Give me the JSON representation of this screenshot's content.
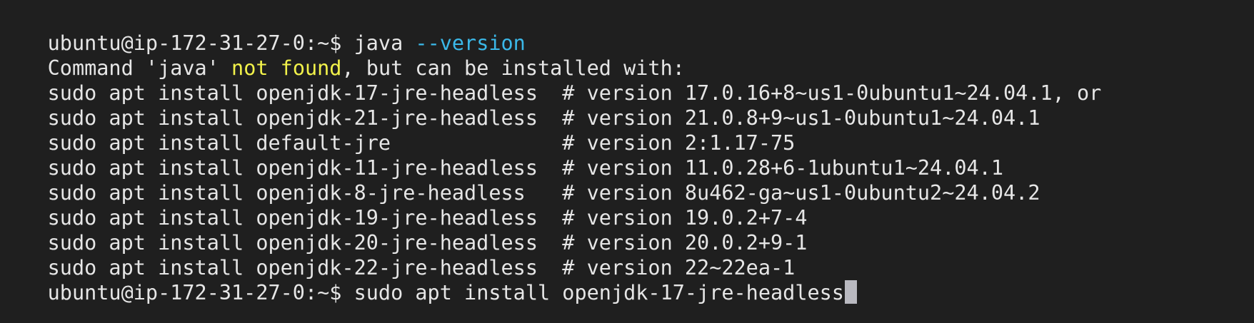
{
  "terminal": {
    "colors": {
      "background": "#1f1f1f",
      "foreground": "#e6e6e6",
      "option": "#3bb8e8",
      "highlight": "#f2f24a",
      "cursor": "#b9b9c0"
    },
    "command1": {
      "prompt": "ubuntu@ip-172-31-27-0:~$ ",
      "program": "java ",
      "option": "--version"
    },
    "error": {
      "prefix": "Command 'java' ",
      "highlight": "not found",
      "suffix": ", but can be installed with:"
    },
    "suggestions": [
      {
        "install": "sudo apt install openjdk-17-jre-headless  ",
        "version": "# version 17.0.16+8~us1-0ubuntu1~24.04.1, or"
      },
      {
        "install": "sudo apt install openjdk-21-jre-headless  ",
        "version": "# version 21.0.8+9~us1-0ubuntu1~24.04.1"
      },
      {
        "install": "sudo apt install default-jre              ",
        "version": "# version 2:1.17-75"
      },
      {
        "install": "sudo apt install openjdk-11-jre-headless  ",
        "version": "# version 11.0.28+6-1ubuntu1~24.04.1"
      },
      {
        "install": "sudo apt install openjdk-8-jre-headless   ",
        "version": "# version 8u462-ga~us1-0ubuntu2~24.04.2"
      },
      {
        "install": "sudo apt install openjdk-19-jre-headless  ",
        "version": "# version 19.0.2+7-4"
      },
      {
        "install": "sudo apt install openjdk-20-jre-headless  ",
        "version": "# version 20.0.2+9-1"
      },
      {
        "install": "sudo apt install openjdk-22-jre-headless  ",
        "version": "# version 22~22ea-1"
      }
    ],
    "command2": {
      "prompt": "ubuntu@ip-172-31-27-0:~$ ",
      "input": "sudo apt install openjdk-17-jre-headless"
    }
  }
}
